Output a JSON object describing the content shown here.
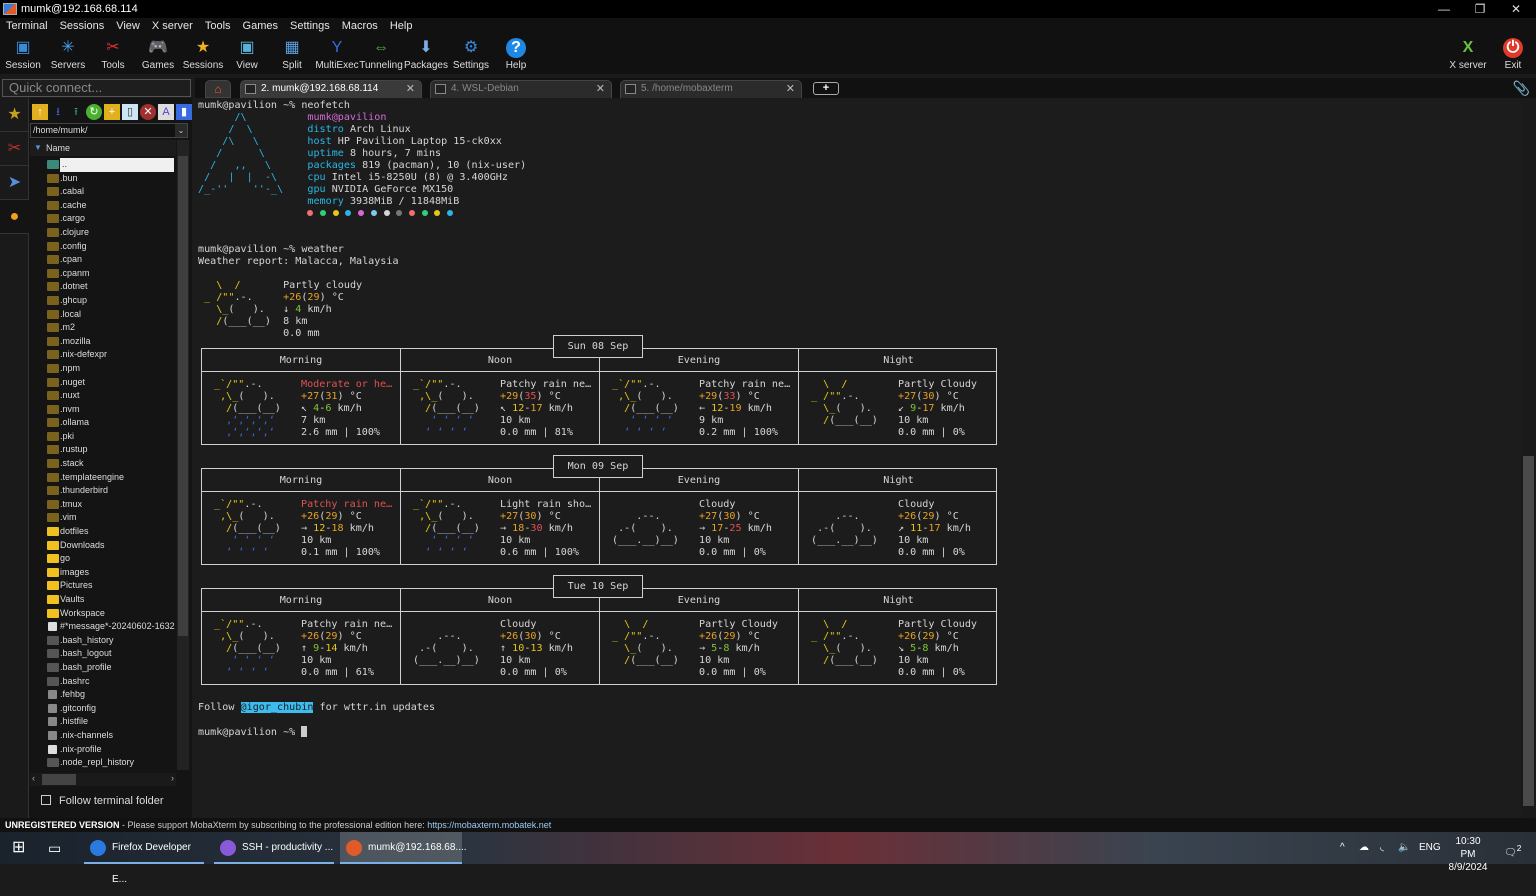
{
  "window": {
    "title": "mumk@192.168.68.114"
  },
  "menu": [
    "Terminal",
    "Sessions",
    "View",
    "X server",
    "Tools",
    "Games",
    "Settings",
    "Macros",
    "Help"
  ],
  "toolbar": [
    {
      "label": "Session",
      "icon": "session-icon"
    },
    {
      "label": "Servers",
      "icon": "servers-icon"
    },
    {
      "label": "Tools",
      "icon": "tools-icon"
    },
    {
      "label": "Games",
      "icon": "gamepad-icon"
    },
    {
      "label": "Sessions",
      "icon": "star-icon"
    },
    {
      "label": "View",
      "icon": "view-icon"
    },
    {
      "label": "Split",
      "icon": "split-icon"
    },
    {
      "label": "MultiExec",
      "icon": "multiexec-icon"
    },
    {
      "label": "Tunneling",
      "icon": "tunneling-icon"
    },
    {
      "label": "Packages",
      "icon": "packages-icon"
    },
    {
      "label": "Settings",
      "icon": "gear-icon"
    },
    {
      "label": "Help",
      "icon": "help-icon"
    }
  ],
  "toolbar_right": [
    {
      "label": "X server",
      "icon": "xserver-icon"
    },
    {
      "label": "Exit",
      "icon": "power-icon"
    }
  ],
  "quick_connect": {
    "placeholder": "Quick connect..."
  },
  "tabs": [
    {
      "label": "2. mumk@192.168.68.114",
      "active": true
    },
    {
      "label": "4. WSL-Debian",
      "active": false
    },
    {
      "label": "5. /home/mobaxterm",
      "active": false
    }
  ],
  "sidebar": {
    "path": "/home/mumk/",
    "column_header": "Name",
    "files": [
      {
        "name": "..",
        "type": "up",
        "selected": true
      },
      {
        "name": ".bun",
        "type": "dotdir"
      },
      {
        "name": ".cabal",
        "type": "dotdir"
      },
      {
        "name": ".cache",
        "type": "dotdir"
      },
      {
        "name": ".cargo",
        "type": "dotdir"
      },
      {
        "name": ".clojure",
        "type": "dotdir"
      },
      {
        "name": ".config",
        "type": "dotdir"
      },
      {
        "name": ".cpan",
        "type": "dotdir"
      },
      {
        "name": ".cpanm",
        "type": "dotdir"
      },
      {
        "name": ".dotnet",
        "type": "dotdir"
      },
      {
        "name": ".ghcup",
        "type": "dotdir"
      },
      {
        "name": ".local",
        "type": "dotdir"
      },
      {
        "name": ".m2",
        "type": "dotdir"
      },
      {
        "name": ".mozilla",
        "type": "dotdir"
      },
      {
        "name": ".nix-defexpr",
        "type": "dotdir"
      },
      {
        "name": ".npm",
        "type": "dotdir"
      },
      {
        "name": ".nuget",
        "type": "dotdir"
      },
      {
        "name": ".nuxt",
        "type": "dotdir"
      },
      {
        "name": ".nvm",
        "type": "dotdir"
      },
      {
        "name": ".ollama",
        "type": "dotdir"
      },
      {
        "name": ".pki",
        "type": "dotdir"
      },
      {
        "name": ".rustup",
        "type": "dotdir"
      },
      {
        "name": ".stack",
        "type": "dotdir"
      },
      {
        "name": ".templateengine",
        "type": "dotdir"
      },
      {
        "name": ".thunderbird",
        "type": "dotdir"
      },
      {
        "name": ".tmux",
        "type": "dotdir"
      },
      {
        "name": ".vim",
        "type": "dotdir"
      },
      {
        "name": "dotfiles",
        "type": "dir"
      },
      {
        "name": "Downloads",
        "type": "dir"
      },
      {
        "name": "go",
        "type": "dir"
      },
      {
        "name": "images",
        "type": "dir"
      },
      {
        "name": "Pictures",
        "type": "dir"
      },
      {
        "name": "Vaults",
        "type": "dir"
      },
      {
        "name": "Workspace",
        "type": "dir"
      },
      {
        "name": "#*message*-20240602-1632",
        "type": "doc"
      },
      {
        "name": ".bash_history",
        "type": "file"
      },
      {
        "name": ".bash_logout",
        "type": "file"
      },
      {
        "name": ".bash_profile",
        "type": "file"
      },
      {
        "name": ".bashrc",
        "type": "file"
      },
      {
        "name": ".fehbg",
        "type": "gray"
      },
      {
        "name": ".gitconfig",
        "type": "gray"
      },
      {
        "name": ".histfile",
        "type": "gray"
      },
      {
        "name": ".nix-channels",
        "type": "gray"
      },
      {
        "name": ".nix-profile",
        "type": "link"
      },
      {
        "name": ".node_repl_history",
        "type": "file"
      }
    ],
    "follow_label": "Follow terminal folder"
  },
  "terminal": {
    "prompt": "mumk@pavilion ~% ",
    "cmd1": "neofetch",
    "neofetch": {
      "logo": [
        "      /\\",
        "     /  \\",
        "    /\\   \\",
        "   /      \\",
        "  /   ,,   \\",
        " /   |  |  -\\",
        "/_-''    ''-_\\"
      ],
      "userhost": "mumk@pavilion",
      "fields": [
        {
          "k": "distro",
          "v": "Arch Linux"
        },
        {
          "k": "host",
          "v": "HP Pavilion Laptop 15-ck0xx"
        },
        {
          "k": "uptime",
          "v": "8 hours, 7 mins"
        },
        {
          "k": "packages",
          "v": "819 (pacman), 10 (nix-user)"
        },
        {
          "k": "cpu",
          "v": "Intel i5-8250U (8) @ 3.400GHz"
        },
        {
          "k": "gpu",
          "v": "NVIDIA GeForce MX150"
        },
        {
          "k": "memory",
          "v": "3938MiB / 11848MiB"
        }
      ],
      "palette": [
        "#f07070",
        "#2ed07a",
        "#e6c716",
        "#29b6e6",
        "#d36ad6",
        "#7ec8f0",
        "#d6d6d6",
        "#777777",
        "#f07070",
        "#2ed07a",
        "#e6c716",
        "#29b6e6"
      ]
    },
    "cmd2": "weather",
    "weather_report": "Weather report: Malacca, Malaysia",
    "current": {
      "desc": "Partly cloudy",
      "temp": "+26",
      "feels": "29",
      "wind_arrow": "↓",
      "wind": "4",
      "vis": "8 km",
      "precip": "0.0 mm"
    },
    "days": [
      {
        "date": "Sun 08 Sep",
        "periods": [
          {
            "name": "Morning",
            "icon": "heavy-rain",
            "desc": "Moderate or he…",
            "desc_red": true,
            "temp": "+27",
            "feels": "31",
            "arrow": "↖",
            "w1": "4",
            "w2": "6",
            "vis": "7 km",
            "precip": "2.6 mm | 100%"
          },
          {
            "name": "Noon",
            "icon": "patchy-rain",
            "desc": "Patchy rain ne…",
            "temp": "+29",
            "feels": "35",
            "arrow": "↖",
            "w1": "12",
            "w2": "17",
            "vis": "10 km",
            "precip": "0.0 mm | 81%"
          },
          {
            "name": "Evening",
            "icon": "patchy-rain",
            "desc": "Patchy rain ne…",
            "temp": "+29",
            "feels": "33",
            "arrow": "←",
            "w1": "12",
            "w2": "19",
            "vis": "9 km",
            "precip": "0.2 mm | 100%"
          },
          {
            "name": "Night",
            "icon": "partly-cloudy",
            "desc": "Partly Cloudy",
            "temp": "+27",
            "feels": "30",
            "arrow": "↙",
            "w1": "9",
            "w2": "17",
            "vis": "10 km",
            "precip": "0.0 mm | 0%"
          }
        ]
      },
      {
        "date": "Mon 09 Sep",
        "periods": [
          {
            "name": "Morning",
            "icon": "patchy-rain",
            "desc": "Patchy rain ne…",
            "desc_red": true,
            "temp": "+26",
            "feels": "29",
            "arrow": "→",
            "w1": "12",
            "w2": "18",
            "vis": "10 km",
            "precip": "0.1 mm | 100%"
          },
          {
            "name": "Noon",
            "icon": "patchy-rain",
            "desc": "Light rain sho…",
            "temp": "+27",
            "feels": "30",
            "arrow": "→",
            "w1": "18",
            "w2": "30",
            "vis": "10 km",
            "precip": "0.6 mm | 100%"
          },
          {
            "name": "Evening",
            "icon": "cloudy",
            "desc": "Cloudy",
            "temp": "+27",
            "feels": "30",
            "arrow": "→",
            "w1": "17",
            "w2": "25",
            "vis": "10 km",
            "precip": "0.0 mm | 0%"
          },
          {
            "name": "Night",
            "icon": "cloudy",
            "desc": "Cloudy",
            "temp": "+26",
            "feels": "29",
            "arrow": "↗",
            "w1": "11",
            "w2": "17",
            "vis": "10 km",
            "precip": "0.0 mm | 0%"
          }
        ]
      },
      {
        "date": "Tue 10 Sep",
        "periods": [
          {
            "name": "Morning",
            "icon": "patchy-rain",
            "desc": "Patchy rain ne…",
            "temp": "+26",
            "feels": "29",
            "arrow": "↑",
            "w1": "9",
            "w2": "14",
            "vis": "10 km",
            "precip": "0.0 mm | 61%"
          },
          {
            "name": "Noon",
            "icon": "cloudy",
            "desc": "Cloudy",
            "temp": "+26",
            "feels": "30",
            "arrow": "↑",
            "w1": "10",
            "w2": "13",
            "vis": "10 km",
            "precip": "0.0 mm | 0%"
          },
          {
            "name": "Evening",
            "icon": "partly-cloudy",
            "desc": "Partly Cloudy",
            "temp": "+26",
            "feels": "29",
            "arrow": "→",
            "w1": "5",
            "w2": "8",
            "vis": "10 km",
            "precip": "0.0 mm | 0%"
          },
          {
            "name": "Night",
            "icon": "partly-cloudy",
            "desc": "Partly Cloudy",
            "temp": "+26",
            "feels": "29",
            "arrow": "↘",
            "w1": "5",
            "w2": "8",
            "vis": "10 km",
            "precip": "0.0 mm | 0%"
          }
        ]
      }
    ],
    "follow_pre": "Follow ",
    "follow_handle": "@igor_chubin",
    "follow_post": " for wttr.in updates"
  },
  "statusbar": {
    "bold": "UNREGISTERED VERSION",
    "text": " - Please support MobaXterm by subscribing to the professional edition here: ",
    "url": "https://mobaxterm.mobatek.net"
  },
  "taskbar": {
    "apps": [
      {
        "label": "Firefox Developer E...",
        "color": "#2a7ae0"
      },
      {
        "label": "SSH - productivity ...",
        "color": "#8a5ad6"
      },
      {
        "label": "mumk@192.168.68....",
        "color": "#e05a2a",
        "active": true
      }
    ],
    "tray": {
      "lang": "ENG",
      "time": "10:30 PM",
      "date": "8/9/2024",
      "notifications": "2"
    }
  }
}
